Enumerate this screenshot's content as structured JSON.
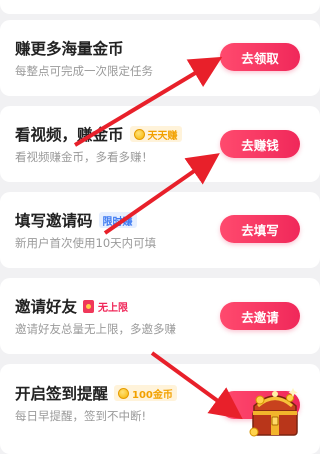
{
  "tasks": [
    {
      "title": "赚更多海量金币",
      "subtitle": "每整点可完成一次限定任务",
      "button": "去领取",
      "badge": null
    },
    {
      "title": "看视频，赚金币",
      "subtitle": "看视频赚金币，多看多赚！",
      "button": "去赚钱",
      "badge": {
        "text": "天天赚",
        "icon": "coin-icon",
        "style": "yellow"
      }
    },
    {
      "title": "填写邀请码",
      "subtitle": "新用户首次使用10天内可填",
      "button": "去填写",
      "badge": {
        "text": "限时赚",
        "icon": null,
        "style": "blue"
      }
    },
    {
      "title": "邀请好友",
      "subtitle": "邀请好友总量无上限，多邀多赚",
      "button": "去邀请",
      "badge": {
        "text": "无上限",
        "icon": "red-packet-icon",
        "style": "red"
      }
    },
    {
      "title": "开启签到提醒",
      "subtitle": "每日早提醒，签到不中断!",
      "button": "",
      "badge": {
        "text": "100金币",
        "icon": "coin-icon",
        "style": "yellow"
      }
    }
  ],
  "colors": {
    "accent": "#f0285a",
    "arrow": "#e8202a",
    "background": "#f1f1f3"
  }
}
